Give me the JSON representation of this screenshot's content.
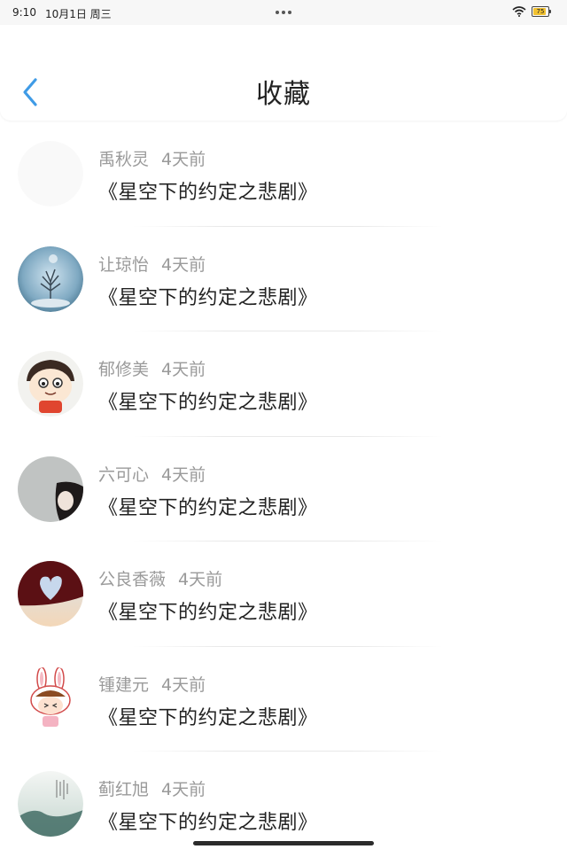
{
  "status_bar": {
    "time": "9:10",
    "date": "10月1日 周三",
    "battery": "75"
  },
  "header": {
    "title": "收藏"
  },
  "items": [
    {
      "name": "禹秋灵",
      "time": "4天前",
      "content": "《星空下的约定之悲剧》",
      "avatar": "blank"
    },
    {
      "name": "让琼怡",
      "time": "4天前",
      "content": "《星空下的约定之悲剧》",
      "avatar": "tree-in-globe"
    },
    {
      "name": "郁修美",
      "time": "4天前",
      "content": "《星空下的约定之悲剧》",
      "avatar": "cartoon-boy"
    },
    {
      "name": "六可心",
      "time": "4天前",
      "content": "《星空下的约定之悲剧》",
      "avatar": "girl-window"
    },
    {
      "name": "公良香薇",
      "time": "4天前",
      "content": "《星空下的约定之悲剧》",
      "avatar": "heart-sky"
    },
    {
      "name": "锺建元",
      "time": "4天前",
      "content": "《星空下的约定之悲剧》",
      "avatar": "bunny-cartoon"
    },
    {
      "name": "蓟红旭",
      "time": "4天前",
      "content": "《星空下的约定之悲剧》",
      "avatar": "ink-landscape"
    }
  ]
}
